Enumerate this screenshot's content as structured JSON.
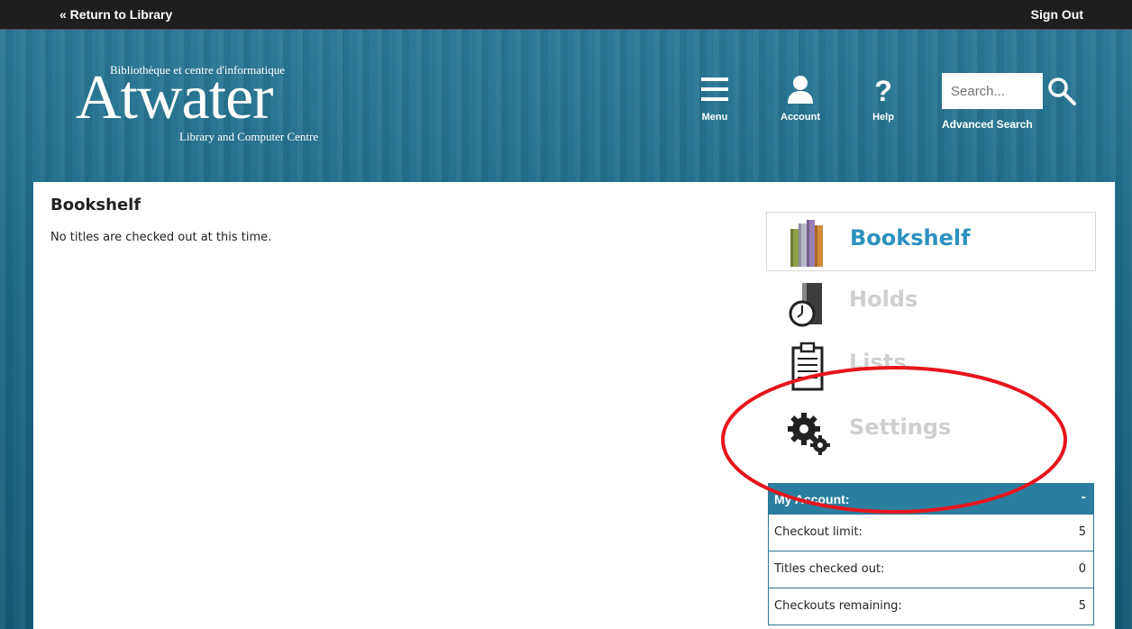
{
  "topbar": {
    "return_label": "« Return to Library",
    "signout_label": "Sign Out"
  },
  "logo": {
    "top_line": "Bibliothèque et centre d'informatique",
    "name": "Atwater",
    "bottom_line": "Library and Computer Centre"
  },
  "nav": {
    "menu_label": "Menu",
    "account_label": "Account",
    "help_label": "Help"
  },
  "search": {
    "placeholder": "Search...",
    "advanced_label": "Advanced Search"
  },
  "main": {
    "title": "Bookshelf",
    "empty_message": "No titles are checked out at this time."
  },
  "sidebar": {
    "items": [
      {
        "label": "Bookshelf",
        "icon": "bookshelf-icon",
        "active": true
      },
      {
        "label": "Holds",
        "icon": "holds-icon",
        "active": false
      },
      {
        "label": "Lists",
        "icon": "lists-icon",
        "active": false
      },
      {
        "label": "Settings",
        "icon": "settings-icon",
        "active": false
      }
    ]
  },
  "account": {
    "title": "My Account:",
    "toggle": "-",
    "rows": [
      {
        "label": "Checkout limit:",
        "value": "5"
      },
      {
        "label": "Titles checked out:",
        "value": "0"
      },
      {
        "label": "Checkouts remaining:",
        "value": "5"
      }
    ]
  },
  "colors": {
    "accent": "#2b92bd",
    "header_bg": "#1d6a86",
    "annotation": "#e8141c"
  }
}
